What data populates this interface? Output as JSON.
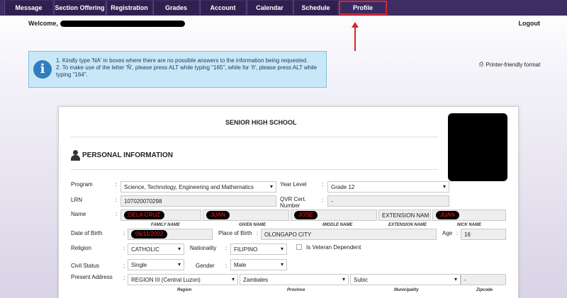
{
  "nav": {
    "items": [
      {
        "label": "Message",
        "left": 0,
        "width": 72
      },
      {
        "label": "Section Offering",
        "width": 68
      },
      {
        "label": "Registration"
      },
      {
        "label": "Grades"
      },
      {
        "label": "Account"
      },
      {
        "label": "Calendar"
      },
      {
        "label": "Schedule"
      },
      {
        "label": "Profile"
      }
    ]
  },
  "header": {
    "welcome": "Welcome,",
    "logout": "Logout"
  },
  "notice": {
    "line1": "1. Kindly type 'NA' in boxes where there are no possible answers to the information being requested.",
    "line2": "2. To make use of the letter 'Ñ', please press ALT while typing \"165\", while for 'ñ', please press ALT while typing \"164\".",
    "icon": "info-icon"
  },
  "printer": {
    "label": "Printer-friendly format",
    "icon": "printer-icon"
  },
  "form": {
    "school_title": "SENIOR HIGH SCHOOL",
    "section_title": "PERSONAL INFORMATION",
    "program_label": "Program",
    "program_value": "Science, Technology, Engineering and Mathematics",
    "year_level_label": "Year Level",
    "year_level_value": "Grade 12",
    "lrn_label": "LRN",
    "lrn_value": "107020070298",
    "qvr_label": "QVR Cert. Number",
    "qvr_value": "-",
    "name_label": "Name",
    "family_name_value": "DELA CRUZ",
    "given_name_value": "JUAN",
    "middle_name_value": "JOSE",
    "extension_label": "EXTENSION NAM",
    "nick_name_value": "JUAN",
    "family_name_sub": "FAMILY NAME",
    "given_name_sub": "GIVEN NAME",
    "middle_name_sub": "MIDDLE NAME",
    "extension_name_sub": "EXTENSION NAME",
    "nick_name_sub": "NICK NAME",
    "dob_label": "Date of Birth",
    "dob_value": "06/11/2002",
    "pob_label": "Place of Birth",
    "pob_value": "OLONGAPO CITY",
    "age_label": "Age",
    "age_value": "16",
    "religion_label": "Religion",
    "religion_value": "CATHOLIC",
    "nationality_label": "Nationality",
    "nationality_value": "FILIPINO",
    "veteran_label": "Is Veteran Dependent",
    "civil_label": "Civil Status",
    "civil_value": "Single",
    "gender_label": "Gender",
    "gender_value": "Male",
    "address_label": "Present Address",
    "region_value": "REGION III (Central Luzon)",
    "province_value": "Zambales",
    "municipality_value": "Subic",
    "zip_value": "-",
    "region_sub": "Region",
    "province_sub": "Province",
    "municipality_sub": "Municipality",
    "zip_sub": "Zipcode"
  }
}
